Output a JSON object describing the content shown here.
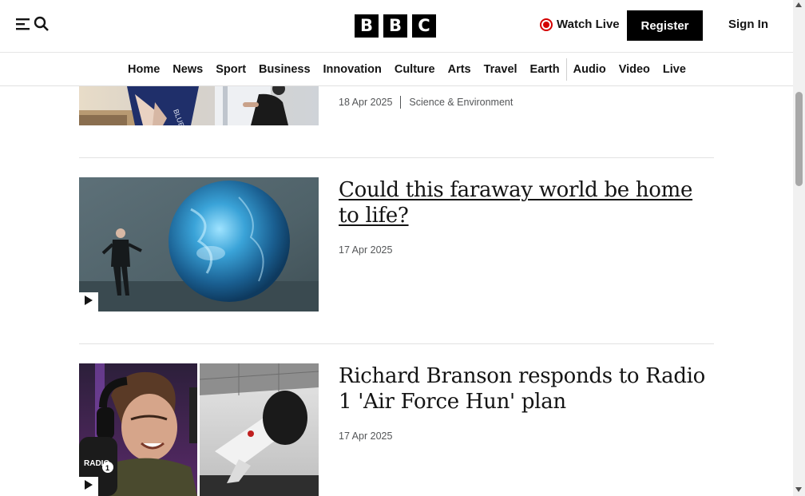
{
  "header": {
    "logo_letters": [
      "B",
      "B",
      "C"
    ],
    "watch_live_label": "Watch Live",
    "register_label": "Register",
    "sign_in_label": "Sign In",
    "live_color": "#d40000"
  },
  "nav": {
    "items": [
      {
        "label": "Home"
      },
      {
        "label": "News"
      },
      {
        "label": "Sport"
      },
      {
        "label": "Business"
      },
      {
        "label": "Innovation"
      },
      {
        "label": "Culture"
      },
      {
        "label": "Arts"
      },
      {
        "label": "Travel"
      },
      {
        "label": "Earth"
      },
      {
        "label": "Audio"
      },
      {
        "label": "Video"
      },
      {
        "label": "Live"
      }
    ]
  },
  "articles": [
    {
      "date": "18 Apr 2025",
      "topic": "Science & Environment",
      "thumb_icon": "astronaut-crew-photo"
    },
    {
      "headline": "Could this faraway world be home to life?",
      "date": "17 Apr 2025",
      "thumb_icon": "presenter-with-planet-photo",
      "has_video": true
    },
    {
      "headline": "Richard Branson responds to Radio 1 'Air Force Hun' plan",
      "date": "17 Apr 2025",
      "thumb_icon": "radio-presenter-and-rocket-photo",
      "has_video": true
    }
  ],
  "icons": {
    "menu": "menu-icon",
    "search": "search-icon",
    "play": "play-icon"
  },
  "colors": {
    "brand_black": "#000000",
    "text": "#141414",
    "meta_text": "#545658"
  }
}
